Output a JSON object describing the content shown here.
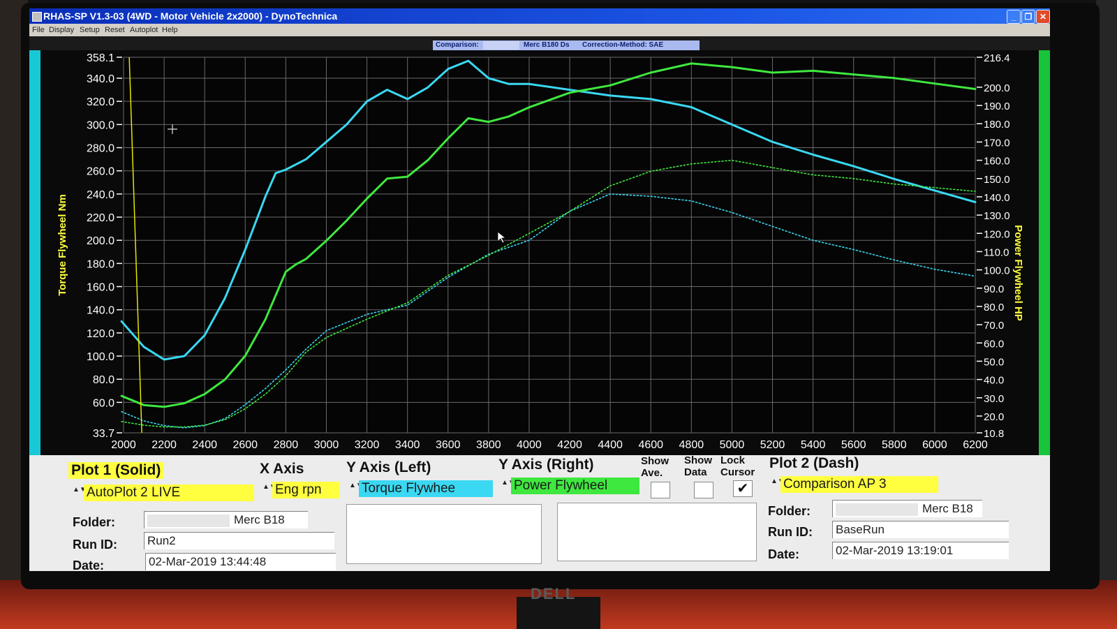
{
  "window": {
    "title": "RHAS-SP V1.3-03  (4WD - Motor Vehicle 2x2000) - DynoTechnica",
    "controls": [
      "_",
      "❐",
      "✕"
    ]
  },
  "menu": [
    "File",
    "Display",
    "Setup",
    "Reset",
    "Autoplot",
    "Help"
  ],
  "infobar": {
    "comparison_label": "Comparison:",
    "vehicle": "Merc B180 Ds",
    "correction": "Correction-Method: SAE"
  },
  "colors": {
    "plot1": "#3ad8f2",
    "plot2": "#3fe83f",
    "left_accent": "#17c9d6",
    "right_accent": "#17c43a",
    "cursor": "#e6e600",
    "grid": "#6a6a6a",
    "label_yellow": "#ffff40"
  },
  "chart_data": {
    "type": "line",
    "x_unit_label": "Eng rpm",
    "ylabel_left": "Torque Flywheel Nm",
    "ylabel_right": "Power Flywheel HP",
    "xlim": [
      2000,
      6200
    ],
    "ylim_left": [
      33.7,
      358.1
    ],
    "ylim_right": [
      10.8,
      216.4
    ],
    "x_ticks": [
      2000,
      2200,
      2400,
      2600,
      2800,
      3000,
      3200,
      3400,
      3600,
      3800,
      4000,
      4200,
      4400,
      4600,
      4800,
      5000,
      5200,
      5400,
      5600,
      5800,
      6000,
      6200
    ],
    "y_ticks_left": [
      "358.1",
      "340.0",
      "320.0",
      "300.0",
      "280.0",
      "260.0",
      "240.0",
      "220.0",
      "200.0",
      "180.0",
      "160.0",
      "140.0",
      "120.0",
      "100.0",
      "80.0",
      "60.0",
      "33.7"
    ],
    "y_ticks_right": [
      "216.4",
      "200.0",
      "190.0",
      "180.0",
      "170.0",
      "160.0",
      "150.0",
      "140.0",
      "130.0",
      "120.0",
      "110.0",
      "100.0",
      "90.0",
      "80.0",
      "70.0",
      "60.0",
      "50.0",
      "40.0",
      "30.0",
      "20.0",
      "10.8"
    ],
    "grid": true,
    "cursor_rpm": 2090,
    "series": [
      {
        "name": "AutoPlot 2 LIVE",
        "quantity": "Torque Flywheel Nm",
        "axis": "left",
        "style": "solid",
        "color": "#3ad8f2",
        "x": [
          1990,
          2100,
          2200,
          2300,
          2400,
          2500,
          2600,
          2700,
          2750,
          2800,
          2900,
          3000,
          3100,
          3200,
          3300,
          3400,
          3500,
          3600,
          3700,
          3800,
          3900,
          4000,
          4200,
          4400,
          4600,
          4800,
          5000,
          5200,
          5400,
          5600,
          5800,
          6000,
          6200
        ],
        "y": [
          130,
          108,
          97,
          100,
          118,
          150,
          192,
          238,
          258,
          261,
          270,
          285,
          300,
          320,
          330,
          322,
          332,
          348,
          355,
          340,
          335,
          335,
          330,
          325,
          322,
          315,
          300,
          285,
          274,
          264,
          253,
          243,
          233
        ]
      },
      {
        "name": "AutoPlot 2 LIVE",
        "quantity": "Power Flywheel HP",
        "axis": "right",
        "style": "solid",
        "color": "#3fe83f",
        "x": [
          1990,
          2100,
          2200,
          2300,
          2400,
          2500,
          2600,
          2700,
          2800,
          2850,
          2900,
          3000,
          3100,
          3200,
          3300,
          3400,
          3500,
          3600,
          3700,
          3800,
          3900,
          4000,
          4200,
          4400,
          4600,
          4800,
          5000,
          5200,
          5400,
          5600,
          5800,
          6000,
          6200
        ],
        "y": [
          31,
          26,
          25,
          27,
          32,
          40,
          53,
          73,
          99,
          103,
          106,
          116,
          127,
          139,
          150,
          151,
          160,
          172,
          183,
          181,
          184,
          189,
          197,
          201,
          208,
          213,
          211,
          208,
          209,
          207,
          205,
          202,
          199
        ]
      },
      {
        "name": "Comparison AP 3",
        "quantity": "Torque Flywheel Nm",
        "axis": "left",
        "style": "dash",
        "color": "#3ad8f2",
        "x": [
          1990,
          2100,
          2200,
          2300,
          2400,
          2500,
          2600,
          2700,
          2800,
          2900,
          3000,
          3200,
          3400,
          3600,
          3800,
          4000,
          4200,
          4400,
          4600,
          4800,
          5000,
          5200,
          5400,
          5600,
          5800,
          6000,
          6200
        ],
        "y": [
          52,
          44,
          40,
          38,
          40,
          46,
          58,
          72,
          88,
          106,
          122,
          136,
          144,
          168,
          188,
          200,
          225,
          240,
          238,
          234,
          224,
          212,
          200,
          192,
          183,
          175,
          169
        ]
      },
      {
        "name": "Comparison AP 3",
        "quantity": "Power Flywheel HP",
        "axis": "right",
        "style": "dash",
        "color": "#3fe83f",
        "x": [
          1990,
          2100,
          2200,
          2300,
          2400,
          2500,
          2600,
          2700,
          2800,
          2900,
          3000,
          3200,
          3400,
          3600,
          3800,
          4000,
          4200,
          4400,
          4600,
          4800,
          5000,
          5200,
          5400,
          5600,
          5800,
          6000,
          6200
        ],
        "y": [
          17,
          15,
          14,
          14,
          15,
          18,
          24,
          32,
          42,
          55,
          63,
          73,
          82,
          97,
          108,
          120,
          132,
          146,
          154,
          158,
          160,
          156,
          152,
          150,
          147,
          145,
          143
        ]
      }
    ]
  },
  "panel": {
    "plot1": {
      "header": "Plot 1 (Solid)",
      "source": "AutoPlot 2 LIVE",
      "folder_label": "Folder:",
      "folder_value": "Merc B18",
      "runid_label": "Run ID:",
      "runid_value": "Run2",
      "date_label": "Date:",
      "date_value": "02-Mar-2019   13:44:48"
    },
    "x_axis": {
      "header": "X Axis",
      "value": "Eng rpn"
    },
    "y_left": {
      "header": "Y Axis (Left)",
      "value": "Torque Flywhee"
    },
    "y_right": {
      "header": "Y Axis (Right)",
      "value": "Power Flywheel"
    },
    "checks": {
      "show_ave_line1": "Show",
      "show_ave_line2": "Ave.",
      "show_data_line1": "Show",
      "show_data_line2": "Data",
      "lock_cursor_line1": "Lock",
      "lock_cursor_line2": "Cursor",
      "show_ave_checked": false,
      "show_data_checked": false,
      "lock_cursor_checked": true,
      "checkmark": "✔"
    },
    "plot2": {
      "header": "Plot 2 (Dash)",
      "source": "Comparison AP 3",
      "folder_label": "Folder:",
      "folder_value": "Merc B18",
      "runid_label": "Run ID:",
      "runid_value": "BaseRun",
      "date_label": "Date:",
      "date_value": "02-Mar-2019   13:19:01"
    },
    "spin_glyph": "▲▼"
  },
  "monitor_brand": "DELL"
}
